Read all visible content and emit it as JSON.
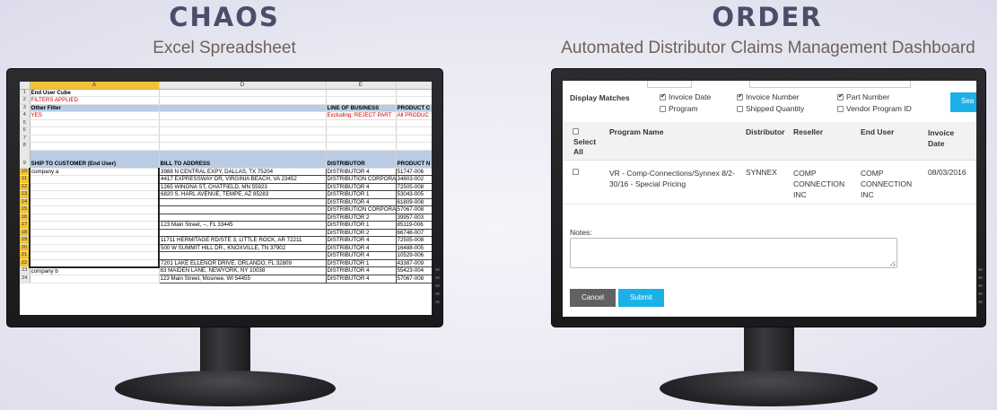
{
  "left_panel": {
    "title": "CHAOS",
    "subtitle": "Excel Spreadsheet",
    "sheet": {
      "col_headers": [
        "A",
        "D",
        "E",
        ""
      ],
      "rows": [
        {
          "n": "1",
          "a": "End User Cube",
          "d": "",
          "e": "",
          "f": ""
        },
        {
          "n": "2",
          "a": "FILTERS APPLIED",
          "d": "",
          "e": "",
          "f": ""
        },
        {
          "n": "3",
          "a": "Other Filter",
          "d": "",
          "e": "LINE OF BUSINESS",
          "f": "PRODUCT C"
        },
        {
          "n": "4",
          "a": "YES",
          "d": "",
          "e": "Excluding: REJECT PART",
          "f": "All PRODUC"
        },
        {
          "n": "5",
          "a": "",
          "d": "",
          "e": "",
          "f": ""
        },
        {
          "n": "6",
          "a": "",
          "d": "",
          "e": "",
          "f": ""
        },
        {
          "n": "7",
          "a": "",
          "d": "",
          "e": "",
          "f": ""
        },
        {
          "n": "8",
          "a": "",
          "d": "",
          "e": "",
          "f": ""
        },
        {
          "n": "9",
          "a": "SHIP TO CUSTOMER (End User)",
          "d": "BILL TO ADDRESS",
          "e": "DISTRIBUTOR",
          "f": "PRODUCT N"
        },
        {
          "n": "10",
          "a": "company a",
          "d": "3988 N CENTRAL EXPY, DALLAS, TX 75204",
          "e": "DISTRIBUTOR 4",
          "f": "51747-006"
        },
        {
          "n": "11",
          "a": "",
          "d": "4417 EXPRESSWAY DR, VIRGINIA BEACH, VA 23452",
          "e": "DISTRIBUTION CORPORA",
          "f": "34803-002"
        },
        {
          "n": "12",
          "a": "",
          "d": "1265 WINONA ST, CHATFIELD, MN 55923",
          "e": "DISTRIBUTOR 4",
          "f": "72505-008"
        },
        {
          "n": "13",
          "a": "",
          "d": "6820 S. HARL AVENUE, TEMPE, AZ 85283",
          "e": "DISTRIBUTOR 1",
          "f": "53043-005"
        },
        {
          "n": "14",
          "a": "",
          "d": "",
          "e": "DISTRIBUTOR 4",
          "f": "61809-008"
        },
        {
          "n": "15",
          "a": "",
          "d": "",
          "e": "DISTRIBUTION CORPORA",
          "f": "57067-008"
        },
        {
          "n": "16",
          "a": "",
          "d": "",
          "e": "DISTRIBUTOR 2",
          "f": "39957-003"
        },
        {
          "n": "17",
          "a": "",
          "d": "123 Main Street, --, FL 33445",
          "e": "DISTRIBUTOR 1",
          "f": "85119-006"
        },
        {
          "n": "18",
          "a": "",
          "d": "",
          "e": "DISTRIBUTOR 2",
          "f": "66748-007"
        },
        {
          "n": "19",
          "a": "",
          "d": "11711 HERMITAGE RD/STE 3, LITTLE ROCK, AR 72211",
          "e": "DISTRIBUTOR 4",
          "f": "72505-008"
        },
        {
          "n": "20",
          "a": "",
          "d": "500 W SUMMIT HILL DR., KNOXVILLE, TN 37902",
          "e": "DISTRIBUTOR 4",
          "f": "16488-005"
        },
        {
          "n": "21",
          "a": "",
          "d": "",
          "e": "DISTRIBUTOR 4",
          "f": "10529-006"
        },
        {
          "n": "22",
          "a": "",
          "d": "7201 LAKE ELLENOR DRIVE, ORLANDO, FL 32809",
          "e": "DISTRIBUTOR 1",
          "f": "43387-009"
        },
        {
          "n": "23",
          "a": "company b",
          "d": "83 MAIDEN LANE, NEWYORK, NY 10038",
          "e": "DISTRIBUTOR 4",
          "f": "55423-004"
        },
        {
          "n": "24",
          "a": "",
          "d": "123 Main Street, Mosinee, WI 54455",
          "e": "DISTRIBUTOR 4",
          "f": "57067-008"
        }
      ]
    }
  },
  "right_panel": {
    "title": "ORDER",
    "subtitle": "Automated Distributor Claims Management Dashboard",
    "dashboard": {
      "display_matches_label": "Display Matches",
      "search_label": "Sea",
      "filters": [
        {
          "label": "Invoice Date",
          "checked": true
        },
        {
          "label": "Invoice Number",
          "checked": true
        },
        {
          "label": "Part Number",
          "checked": true
        },
        {
          "label": "Program",
          "checked": false
        },
        {
          "label": "Shipped Quantity",
          "checked": false
        },
        {
          "label": "Vendor Program ID",
          "checked": false
        }
      ],
      "table": {
        "select_all_label_1": "Select",
        "select_all_label_2": "All",
        "headers": {
          "program": "Program Name",
          "distributor": "Distributor",
          "reseller": "Reseller",
          "end_user": "End User",
          "invoice_date_1": "Invoice",
          "invoice_date_2": "Date"
        },
        "row": {
          "program_1": "VR - Comp-Connections/Synnex 8/2-",
          "program_2": "30/16 - Special Pricing",
          "distributor": "SYNNEX",
          "reseller_1": "COMP",
          "reseller_2": "CONNECTION",
          "reseller_3": "INC",
          "end_user_1": "COMP",
          "end_user_2": "CONNECTION",
          "end_user_3": "INC",
          "invoice_date": "08/03/2016"
        }
      },
      "notes_label": "Notes:",
      "notes_value": "",
      "cancel_label": "Cancel",
      "submit_label": "Submit",
      "colors": {
        "accent": "#1ab1e8",
        "cancel": "#616161"
      }
    }
  }
}
